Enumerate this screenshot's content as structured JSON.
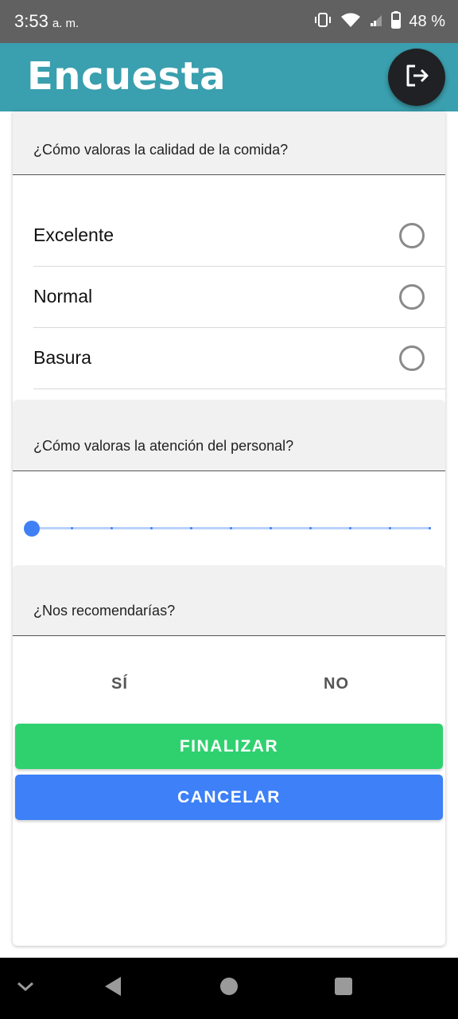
{
  "status_bar": {
    "time": "3:53",
    "ampm": "a. m.",
    "battery": "48 %",
    "icons": [
      "vibrate-icon",
      "wifi-icon",
      "signal-icon",
      "battery-icon"
    ]
  },
  "app_bar": {
    "title": "Encuesta",
    "logout_icon": "logout-icon",
    "color": "#3a9fae"
  },
  "questions": [
    {
      "text": "¿Cómo valoras la calidad de la comida?",
      "type": "radio",
      "options": [
        "Excelente",
        "Normal",
        "Basura"
      ]
    },
    {
      "text": "¿Cómo valoras la atención del personal?",
      "type": "slider",
      "value": 0,
      "steps": 10
    },
    {
      "text": "¿Nos recomendarías?",
      "type": "choice",
      "options": [
        "SÍ",
        "NO"
      ]
    }
  ],
  "buttons": {
    "finish": "FINALIZAR",
    "cancel": "CANCELAR",
    "finish_color": "#2fd16f",
    "cancel_color": "#3d80f7"
  },
  "nav_bar": {
    "icons": [
      "chevron-down-icon",
      "back-icon",
      "home-icon",
      "recents-icon"
    ]
  }
}
